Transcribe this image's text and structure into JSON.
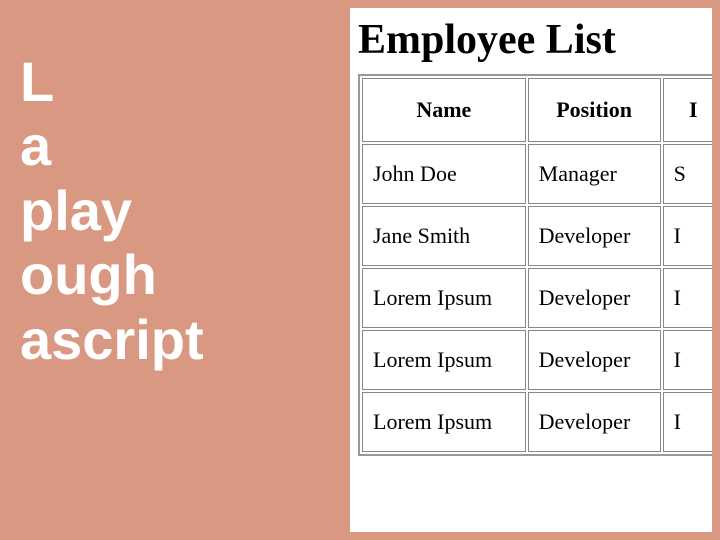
{
  "left": {
    "line1": "L",
    "line2": "a",
    "line3": "play",
    "line4": "ough",
    "line5": "ascript"
  },
  "panel": {
    "title": "Employee List",
    "table": {
      "headers": [
        "Name",
        "Position",
        "I"
      ],
      "rows": [
        [
          "John Doe",
          "Manager",
          "S"
        ],
        [
          "Jane Smith",
          "Developer",
          "I"
        ],
        [
          "Lorem Ipsum",
          "Developer",
          "I"
        ],
        [
          "Lorem Ipsum",
          "Developer",
          "I"
        ],
        [
          "Lorem Ipsum",
          "Developer",
          "I"
        ]
      ]
    }
  }
}
